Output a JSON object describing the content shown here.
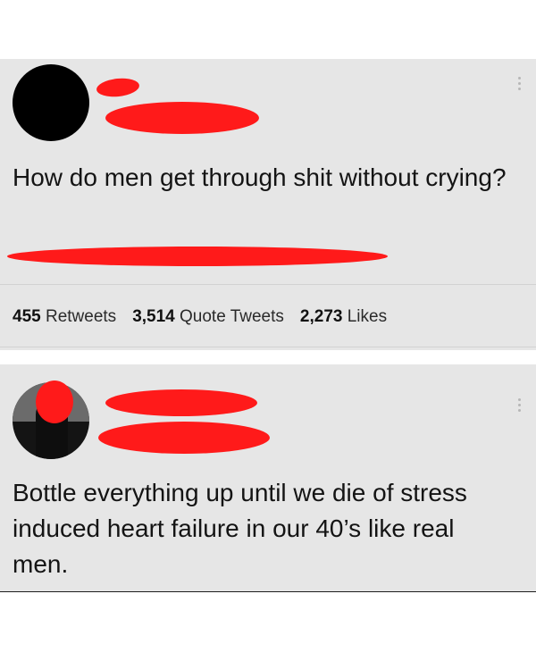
{
  "tweet1": {
    "text": "How do men get through shit without crying?",
    "stats": {
      "retweets_count": "455",
      "retweets_label": "Retweets",
      "quotes_count": "3,514",
      "quotes_label": "Quote Tweets",
      "likes_count": "2,273",
      "likes_label": "Likes"
    }
  },
  "tweet2": {
    "text": "Bottle everything up until we die of stress induced heart failure in our 40’s like real men."
  },
  "colors": {
    "redaction": "#ff1a1a",
    "card_background": "#e6e6e6"
  },
  "icons": [
    "more-options-icon"
  ]
}
